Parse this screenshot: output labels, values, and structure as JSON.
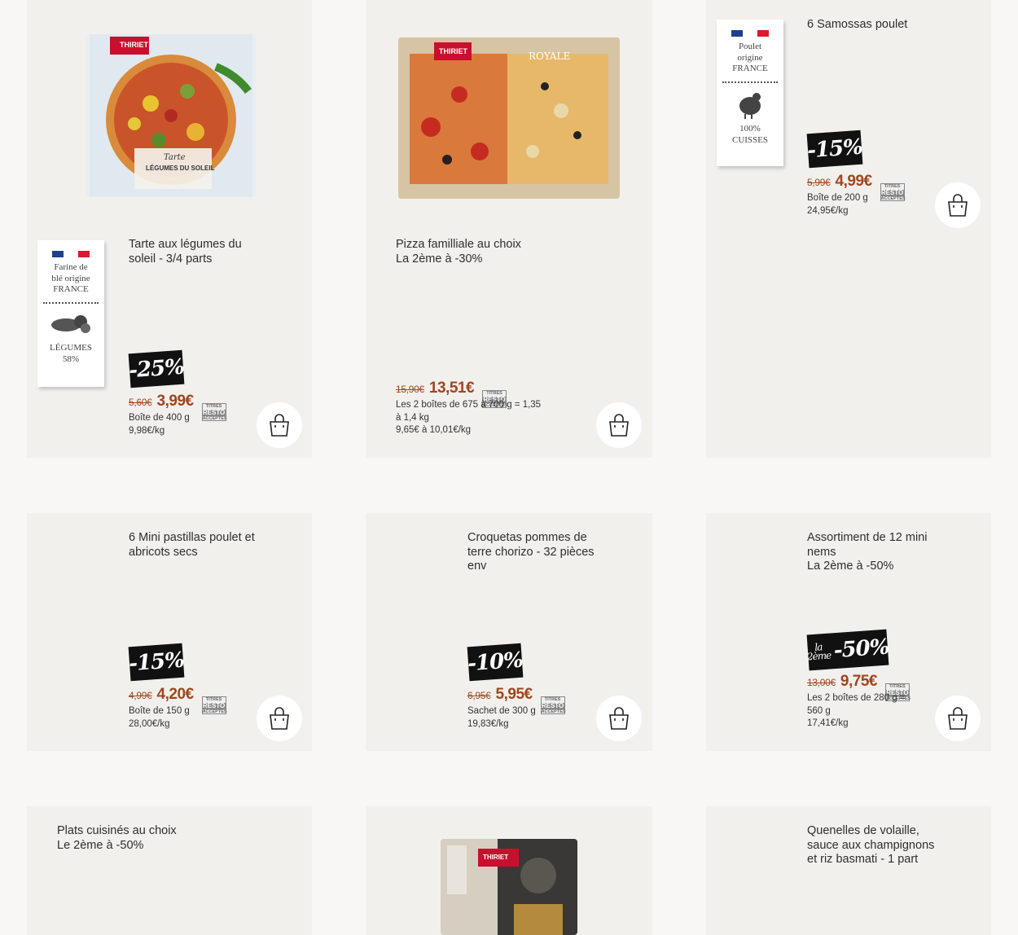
{
  "colors": {
    "price": "#a0461d",
    "card_bg": "#f2f0ed",
    "page_bg": "#f8f7f5",
    "badge_bg": "#111111"
  },
  "resto_badge": {
    "line1": "TITRES",
    "line2": "RESTO",
    "line3": "ACCEPTÉS"
  },
  "products": [
    {
      "title": "Tarte aux légumes du\nsoleil - 3/4 parts",
      "badge": "-25%",
      "old_price": "5,60€",
      "new_price": "3,99€",
      "info": "Boîte de 400 g\n9,98€/kg",
      "image": {
        "brand": "THIRIET",
        "caption1": "Tarte",
        "caption2": "LÉGUMES DU SOLEIL"
      },
      "origin_label": {
        "line1": "Farine de",
        "line2": "blé origine",
        "line3": "FRANCE",
        "bottom1": "LÉGUMES",
        "bottom2": "58%",
        "icon": "vegetables-icon"
      }
    },
    {
      "title": "Pizza familliale au choix\nLa 2ème à -30%",
      "badge": "",
      "old_price": "15,90€",
      "new_price": "13,51€",
      "info": "Les 2 boîtes de 675 à 700 g = 1,35\nà 1,4 kg\n9,65€ à 10,01€/kg",
      "image": {
        "brand": "THIRIET",
        "caption1": "ROYALE"
      }
    },
    {
      "title": "6 Samossas poulet",
      "badge": "-15%",
      "old_price": "5,99€",
      "new_price": "4,99€",
      "info": "Boîte de 200 g\n24,95€/kg",
      "origin_label": {
        "line1": "Poulet",
        "line2": "origine",
        "line3": "FRANCE",
        "bottom1": "100%",
        "bottom2": "CUISSES",
        "icon": "chicken-icon"
      }
    },
    {
      "title": "6 Mini pastillas poulet et\nabricots secs",
      "badge": "-15%",
      "old_price": "4,99€",
      "new_price": "4,20€",
      "info": "Boîte de 150 g\n28,00€/kg"
    },
    {
      "title": "Croquetas pommes de\nterre chorizo - 32 pièces\nenv",
      "badge": "-10%",
      "old_price": "6,95€",
      "new_price": "5,95€",
      "info": "Sachet de 300 g\n19,83€/kg"
    },
    {
      "title": "Assortiment de 12 mini\nnems\nLa 2ème à -50%",
      "badge": "-50%",
      "badge_prefix": "la\n2ème",
      "old_price": "13,00€",
      "new_price": "9,75€",
      "info": "Les 2 boîtes de 280 g =\n560 g\n17,41€/kg"
    },
    {
      "title": "Plats cuisinés au choix\nLe 2ème à -50%"
    },
    {
      "title": "",
      "image": {
        "brand": "THIRIET"
      }
    },
    {
      "title": "Quenelles de volaille,\nsauce aux champignons\net riz basmati - 1 part"
    }
  ]
}
